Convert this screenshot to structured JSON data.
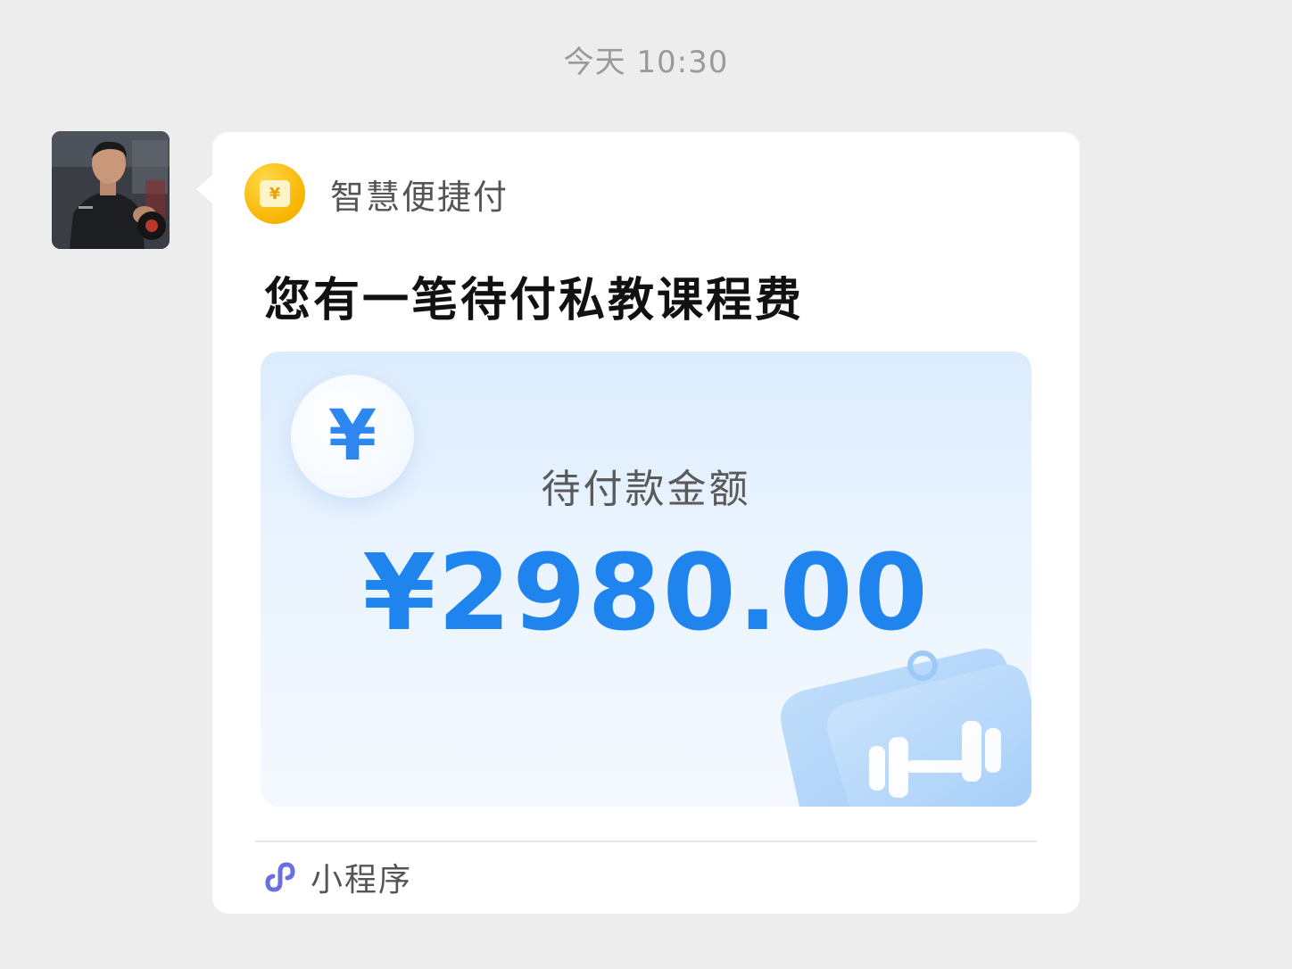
{
  "chat": {
    "timestamp": "今天 10:30"
  },
  "sender": {
    "avatar_icon": "trainer-avatar"
  },
  "card": {
    "app_name": "智慧便捷付",
    "app_icon": "yuan-wallet-icon",
    "title": "您有一笔待付私教课程费",
    "panel": {
      "currency_icon": "yuan-icon",
      "amount_label": "待付款金额",
      "amount": "¥2980.00",
      "decoration_icon": "dumbbell-tag-icon"
    },
    "footer": {
      "icon": "mini-program-icon",
      "label": "小程序"
    }
  },
  "colors": {
    "background": "#ededed",
    "card": "#ffffff",
    "accent_blue": "#1f84ee",
    "app_yellow": "#f7b500"
  }
}
